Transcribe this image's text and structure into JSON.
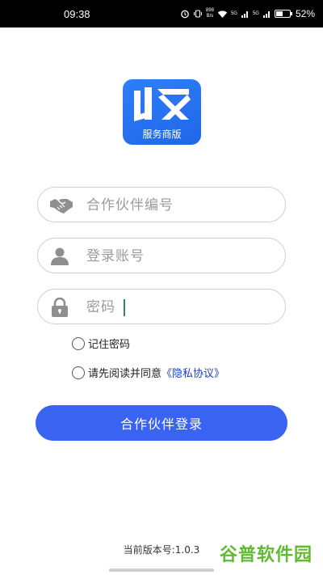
{
  "status_bar": {
    "time": "09:38",
    "speed_value": "898",
    "speed_unit": "B/s",
    "signal_1": "5G",
    "signal_2": "5G",
    "battery": "52%",
    "battery_level": 0.52
  },
  "logo": {
    "icon_name": "shou-logo-icon",
    "label": "服务商版",
    "color": "#2a78f3"
  },
  "form": {
    "partner_id": {
      "placeholder": "合作伙伴编号",
      "value": "",
      "icon": "handshake-icon"
    },
    "account": {
      "placeholder": "登录账号",
      "value": "",
      "icon": "user-icon"
    },
    "password": {
      "placeholder": "密码",
      "value": "",
      "icon": "lock-icon"
    }
  },
  "options": {
    "remember_password": "记住密码",
    "agree_prefix": "请先阅读并同意",
    "agree_link": "《隐私协议》"
  },
  "login_button": {
    "label": "合作伙伴登录",
    "color": "#3b63f1"
  },
  "footer": {
    "version": "当前版本号:1.0.3",
    "watermark": "谷普软件园"
  }
}
